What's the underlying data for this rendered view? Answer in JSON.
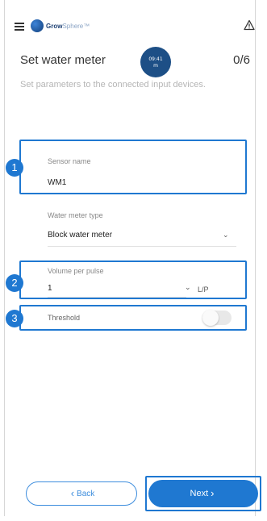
{
  "header": {
    "logo_bold": "Grow",
    "logo_light": "Sphere",
    "logo_tm": "™"
  },
  "page": {
    "title": "Set water meter",
    "step_counter": "0/6",
    "time_badge_line1": "09:41",
    "time_badge_line2": "m",
    "subtitle": "Set parameters to the connected input devices."
  },
  "form": {
    "sensor_name_label": "Sensor name",
    "sensor_name_value": "WM1",
    "meter_type_label": "Water meter type",
    "meter_type_value": "Block water meter",
    "volume_label": "Volume per pulse",
    "volume_value": "1",
    "volume_unit": "L/P",
    "threshold_label": "Threshold",
    "threshold_enabled": false
  },
  "markers": [
    "1",
    "2",
    "3"
  ],
  "footer": {
    "back_label": "Back",
    "next_label": "Next"
  },
  "colors": {
    "accent": "#1f78d1",
    "badge": "#1d4f86",
    "subtitle": "#b5b5b5"
  }
}
